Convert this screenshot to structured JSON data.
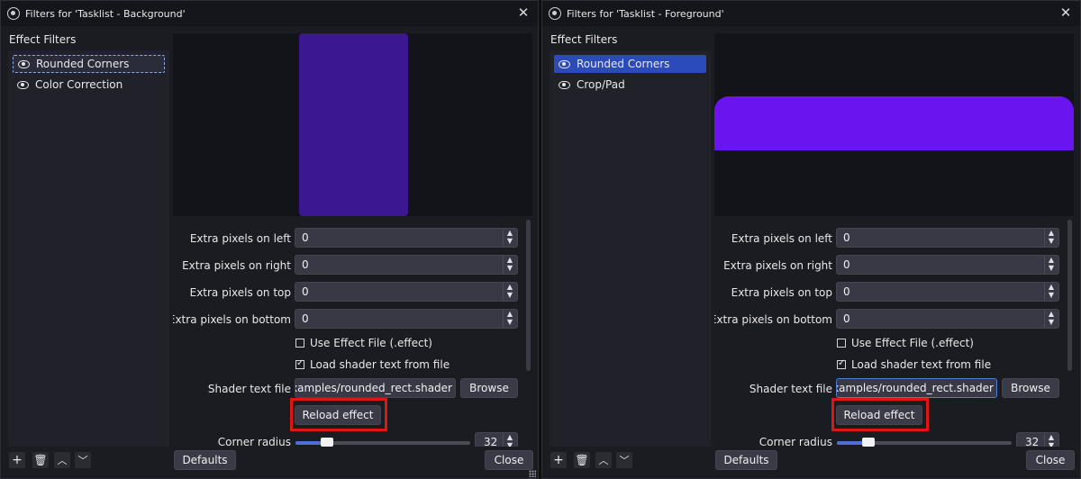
{
  "windows": [
    {
      "title": "Filters for 'Tasklist - Background'",
      "section_label": "Effect Filters",
      "filters": [
        {
          "label": "Rounded Corners",
          "state": "focused"
        },
        {
          "label": "Color Correction",
          "state": "normal"
        }
      ],
      "preview_color": "#3b1791",
      "properties": {
        "extra_left_label": "Extra pixels on left",
        "extra_left_value": "0",
        "extra_right_label": "Extra pixels on right",
        "extra_right_value": "0",
        "extra_top_label": "Extra pixels on top",
        "extra_top_value": "0",
        "extra_bottom_label": "Extra pixels on bottom",
        "extra_bottom_value": "0",
        "use_effect_file_label": "Use Effect File (.effect)",
        "use_effect_file_checked": false,
        "load_shader_label": "Load shader text from file",
        "load_shader_checked": true,
        "shader_file_label": "Shader text file",
        "shader_file_value": "examples/rounded_rect.shader",
        "browse_label": "Browse",
        "reload_label": "Reload effect",
        "corner_radius_label": "Corner radius",
        "corner_radius_value": "32"
      },
      "defaults_label": "Defaults",
      "close_label": "Close"
    },
    {
      "title": "Filters for 'Tasklist - Foreground'",
      "section_label": "Effect Filters",
      "filters": [
        {
          "label": "Rounded Corners",
          "state": "selected"
        },
        {
          "label": "Crop/Pad",
          "state": "normal"
        }
      ],
      "preview_color": "#6a14f0",
      "properties": {
        "extra_left_label": "Extra pixels on left",
        "extra_left_value": "0",
        "extra_right_label": "Extra pixels on right",
        "extra_right_value": "0",
        "extra_top_label": "Extra pixels on top",
        "extra_top_value": "0",
        "extra_bottom_label": "Extra pixels on bottom",
        "extra_bottom_value": "0",
        "use_effect_file_label": "Use Effect File (.effect)",
        "use_effect_file_checked": false,
        "load_shader_label": "Load shader text from file",
        "load_shader_checked": true,
        "shader_file_label": "Shader text file",
        "shader_file_value": "examples/rounded_rect.shader",
        "browse_label": "Browse",
        "reload_label": "Reload effect",
        "corner_radius_label": "Corner radius",
        "corner_radius_value": "32"
      },
      "defaults_label": "Defaults",
      "close_label": "Close"
    }
  ],
  "icons": {
    "close": "close-icon",
    "add": "plus-icon",
    "remove": "trash-icon",
    "move_up": "chevron-up-icon",
    "move_down": "chevron-down-icon",
    "visibility": "eye-icon"
  },
  "accent_color": "#2b4bbb",
  "highlight_color": "#e01616"
}
